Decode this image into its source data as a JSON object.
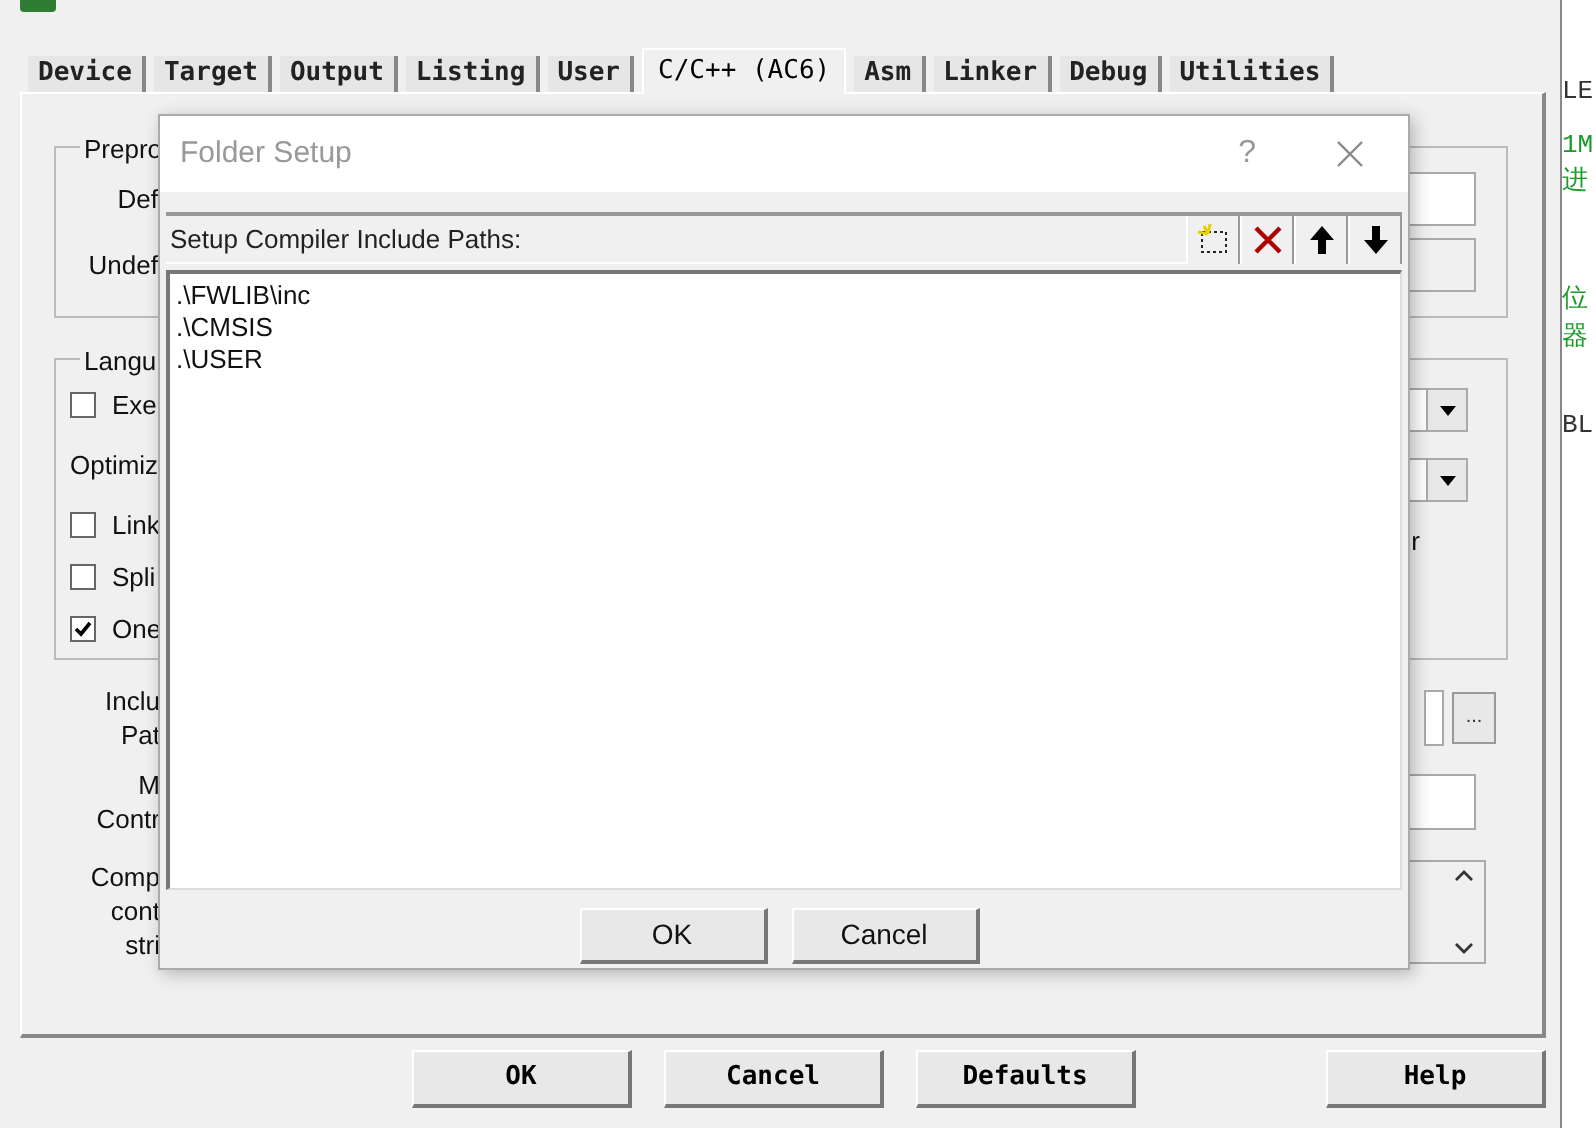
{
  "window": {
    "tabs": [
      {
        "label": "Device",
        "selected": false
      },
      {
        "label": "Target",
        "selected": false
      },
      {
        "label": "Output",
        "selected": false
      },
      {
        "label": "Listing",
        "selected": false
      },
      {
        "label": "User",
        "selected": false
      },
      {
        "label": "C/C++ (AC6)",
        "selected": true
      },
      {
        "label": "Asm",
        "selected": false
      },
      {
        "label": "Linker",
        "selected": false
      },
      {
        "label": "Debug",
        "selected": false
      },
      {
        "label": "Utilities",
        "selected": false
      }
    ],
    "preprocessor_group": {
      "legend": "Prepro",
      "define_label": "Def",
      "undefine_label": "Undef"
    },
    "language_group": {
      "legend": "Langu",
      "right_text": "r",
      "options": [
        {
          "kind": "checkbox",
          "label": "Exe",
          "checked": false
        },
        {
          "kind": "label",
          "label": "Optimiz"
        },
        {
          "kind": "checkbox",
          "label": "Link",
          "checked": false
        },
        {
          "kind": "checkbox",
          "label": "Spli",
          "checked": false
        },
        {
          "kind": "checkbox",
          "label": "One",
          "checked": true
        }
      ]
    },
    "include_paths_label": [
      "Inclu",
      "Pat"
    ],
    "include_browse": "...",
    "misc_label": [
      "M",
      "Contr"
    ],
    "compiler_string_label": [
      "Comp",
      "cont",
      "stri"
    ],
    "buttons": [
      "OK",
      "Cancel",
      "Defaults",
      "Help"
    ]
  },
  "editor_text": [
    {
      "text": "LE",
      "kind": "code"
    },
    {
      "text": "1M",
      "kind": "comment"
    },
    {
      "text": "进",
      "kind": "comment"
    },
    {
      "text": "位",
      "kind": "comment"
    },
    {
      "text": "器",
      "kind": "comment"
    },
    {
      "text": "BL",
      "kind": "code"
    }
  ],
  "folder_setup": {
    "title": "Folder Setup",
    "help": "?",
    "heading": "Setup Compiler Include Paths:",
    "paths": [
      ".\\FWLIB\\inc",
      ".\\CMSIS",
      ".\\USER"
    ],
    "buttons": [
      "OK",
      "Cancel"
    ]
  }
}
